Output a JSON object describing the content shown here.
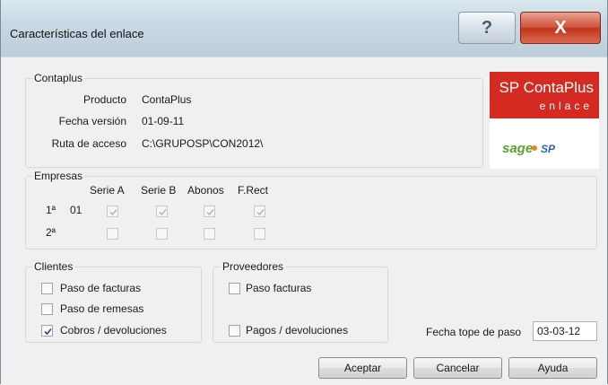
{
  "window": {
    "title": "Características del enlace",
    "help_icon": "?",
    "close_icon": "X"
  },
  "contaplus": {
    "group_label": "Contaplus",
    "producto_label": "Producto",
    "producto_value": "ContaPlus",
    "fecha_label": "Fecha versión",
    "fecha_value": "01-09-11",
    "ruta_label": "Ruta de acceso",
    "ruta_value": "C:\\GRUPOSP\\CON2012\\"
  },
  "logo": {
    "name": "SP ContaPlus",
    "sub": "enlace",
    "sage": "sage",
    "sp": "SP"
  },
  "empresas": {
    "group_label": "Empresas",
    "columns": [
      "Serie A",
      "Serie B",
      "Abonos",
      "F.Rect"
    ],
    "rows": [
      {
        "ordinal": "1ª",
        "code": "01",
        "checks": [
          true,
          true,
          true,
          true
        ]
      },
      {
        "ordinal": "2ª",
        "code": "",
        "checks": [
          false,
          false,
          false,
          false
        ]
      }
    ]
  },
  "clientes": {
    "group_label": "Clientes",
    "items": [
      {
        "label": "Paso de facturas",
        "checked": false
      },
      {
        "label": "Paso de remesas",
        "checked": false
      },
      {
        "label": "Cobros / devoluciones",
        "checked": true
      }
    ]
  },
  "proveedores": {
    "group_label": "Proveedores",
    "items": [
      {
        "label": "Paso facturas",
        "checked": false
      },
      {
        "label": "Pagos / devoluciones",
        "checked": false
      }
    ]
  },
  "fecha_tope": {
    "label": "Fecha tope de paso",
    "value": "03-03-12"
  },
  "buttons": {
    "aceptar": "Aceptar",
    "cancelar": "Cancelar",
    "ayuda": "Ayuda"
  }
}
